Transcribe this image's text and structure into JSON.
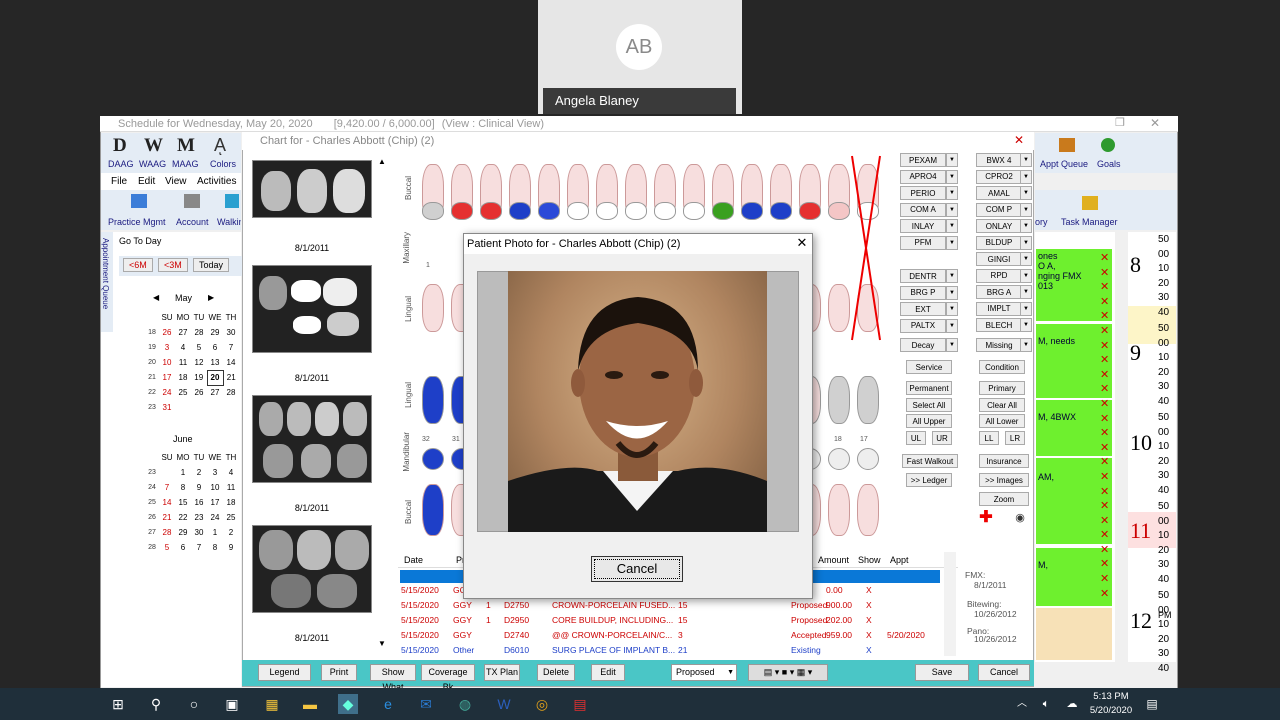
{
  "call": {
    "initials": "AB",
    "participant": "Angela Blaney"
  },
  "main_window": {
    "title": "Schedule for Wednesday, May 20, 2020",
    "values": "[9,420.00 / 6,000.00]",
    "view": "(View : Clinical View)"
  },
  "toolbar": {
    "d": "D",
    "w": "W",
    "m": "M",
    "daag": "DAAG",
    "waag": "WAAG",
    "maag": "MAAG",
    "colors": "Colors"
  },
  "menu": [
    "File",
    "Edit",
    "View",
    "Activities"
  ],
  "toolbar2": [
    "Practice Mgmt",
    "Account",
    "Walkin"
  ],
  "sidebar": {
    "goto": "Go To Day",
    "btn_6m": "<6M",
    "btn_3m": "<3M",
    "btn_today": "Today",
    "month1": "May",
    "month2": "June",
    "vtab": "Appointment Queue",
    "weekdays": [
      "SU",
      "MO",
      "TU",
      "WE",
      "TH"
    ],
    "may_weeks": [
      [
        "18",
        "26",
        "27",
        "28",
        "29",
        "30"
      ],
      [
        "19",
        "3",
        "4",
        "5",
        "6",
        "7"
      ],
      [
        "20",
        "10",
        "11",
        "12",
        "13",
        "14"
      ],
      [
        "21",
        "17",
        "18",
        "19",
        "20",
        "21"
      ],
      [
        "22",
        "24",
        "25",
        "26",
        "27",
        "28"
      ],
      [
        "23",
        "31",
        "",
        "",
        "",
        ""
      ]
    ],
    "june_weeks": [
      [
        "23",
        "",
        "1",
        "2",
        "3",
        "4"
      ],
      [
        "24",
        "7",
        "8",
        "9",
        "10",
        "11"
      ],
      [
        "25",
        "14",
        "15",
        "16",
        "17",
        "18"
      ],
      [
        "26",
        "21",
        "22",
        "23",
        "24",
        "25"
      ],
      [
        "27",
        "28",
        "29",
        "30",
        "1",
        "2"
      ],
      [
        "28",
        "5",
        "6",
        "7",
        "8",
        "9"
      ]
    ]
  },
  "chart_window": {
    "title": "Chart for - Charles Abbott (Chip) (2)"
  },
  "thumbnails": [
    {
      "date": "8/1/2011"
    },
    {
      "date": "8/1/2011"
    },
    {
      "date": "8/1/2011"
    },
    {
      "date": "8/1/2011"
    }
  ],
  "tooth_labels": {
    "buccal": "Buccal",
    "maxillary": "Maxillary",
    "lingual": "Lingual",
    "lingual2": "Lingual",
    "mandibular": "Mandibular",
    "buccal2": "Buccal",
    "n1": "1",
    "n32": "32",
    "n31": "31",
    "n18": "18",
    "n17": "17"
  },
  "codes_left": [
    "PEXAM",
    "APRO4",
    "PERIO",
    "COM A",
    "INLAY",
    "PFM",
    "DENTR",
    "BRG P",
    "EXT",
    "PALTX",
    "Decay"
  ],
  "codes_right": [
    "BWX 4",
    "CPRO2",
    "AMAL",
    "COM P",
    "ONLAY",
    "BLDUP",
    "GINGI",
    "RPD",
    "BRG A",
    "IMPLT",
    "BLECH",
    "Missing"
  ],
  "chart_buttons": {
    "service": "Service",
    "condition": "Condition",
    "permanent": "Permanent",
    "primary": "Primary",
    "select_all": "Select All",
    "clear_all": "Clear All",
    "all_upper": "All Upper",
    "all_lower": "All Lower",
    "ul": "UL",
    "ur": "UR",
    "ll": "LL",
    "lr": "LR",
    "fast_walkout": "Fast Walkout",
    "insurance": "Insurance",
    "ledger": ">> Ledger",
    "images": ">> Images",
    "zoom": "Zoom"
  },
  "grid": {
    "headers": {
      "date": "Date",
      "pr": "Pr",
      "amount": "Amount",
      "show": "Show",
      "appt": "Appt"
    },
    "rows": [
      {
        "date": "5/15/2020",
        "prov": "GGY",
        "tooth": "",
        "code": "",
        "desc": "",
        "qty": "",
        "status": "",
        "amount": "0.00",
        "show": "X",
        "appt": ""
      },
      {
        "date": "5/15/2020",
        "prov": "GGY",
        "tooth": "1",
        "code": "D2750",
        "desc": "CROWN-PORCELAIN FUSED...",
        "qty": "15",
        "status": "Proposed",
        "amount": "900.00",
        "show": "X",
        "appt": ""
      },
      {
        "date": "5/15/2020",
        "prov": "GGY",
        "tooth": "1",
        "code": "D2950",
        "desc": "CORE BUILDUP, INCLUDING...",
        "qty": "15",
        "status": "Proposed",
        "amount": "202.00",
        "show": "X",
        "appt": ""
      },
      {
        "date": "5/15/2020",
        "prov": "GGY",
        "tooth": "",
        "code": "D2740",
        "desc": "@@ CROWN-PORCELAIN/C...",
        "qty": "3",
        "status": "Accepted",
        "amount": "959.00",
        "show": "X",
        "appt": "5/20/2020"
      },
      {
        "date": "5/15/2020",
        "prov": "Other",
        "tooth": "",
        "code": "D6010",
        "desc": "SURG PLACE OF IMPLANT B...",
        "qty": "21",
        "status": "Existing",
        "amount": "",
        "show": "X",
        "appt": ""
      }
    ]
  },
  "right_info": {
    "fmx_label": "FMX:",
    "fmx_date": "8/1/2011",
    "bitewing_label": "Bitewing:",
    "bitewing_date": "10/26/2012",
    "pano_label": "Pano:",
    "pano_date": "10/26/2012"
  },
  "bottom_buttons": {
    "legend": "Legend",
    "print": "Print",
    "show_what": "Show What",
    "coverage": "Coverage Bk",
    "tx_plan": "TX Plan",
    "delete": "Delete",
    "edit": "Edit",
    "status": "Proposed",
    "save": "Save",
    "cancel": "Cancel"
  },
  "right_toolbar": {
    "appt_queue": "Appt Queue",
    "goals": "Goals",
    "ory": "ory",
    "task_manager": "Task Manager"
  },
  "schedule": {
    "appts": [
      "ones\nO A,\nnging FMX\n013",
      "M, needs",
      "M, 4BWX",
      "AM,",
      "M,"
    ],
    "hours": [
      "8",
      "9",
      "10",
      "11",
      "12"
    ],
    "pm": "PM",
    "mins": [
      "50",
      "00",
      "10",
      "20",
      "30",
      "40"
    ]
  },
  "dialog": {
    "title": "Patient Photo for - Charles Abbott (Chip) (2)",
    "cancel": "Cancel"
  },
  "taskbar": {
    "time": "5:13 PM",
    "date": "5/20/2020"
  }
}
